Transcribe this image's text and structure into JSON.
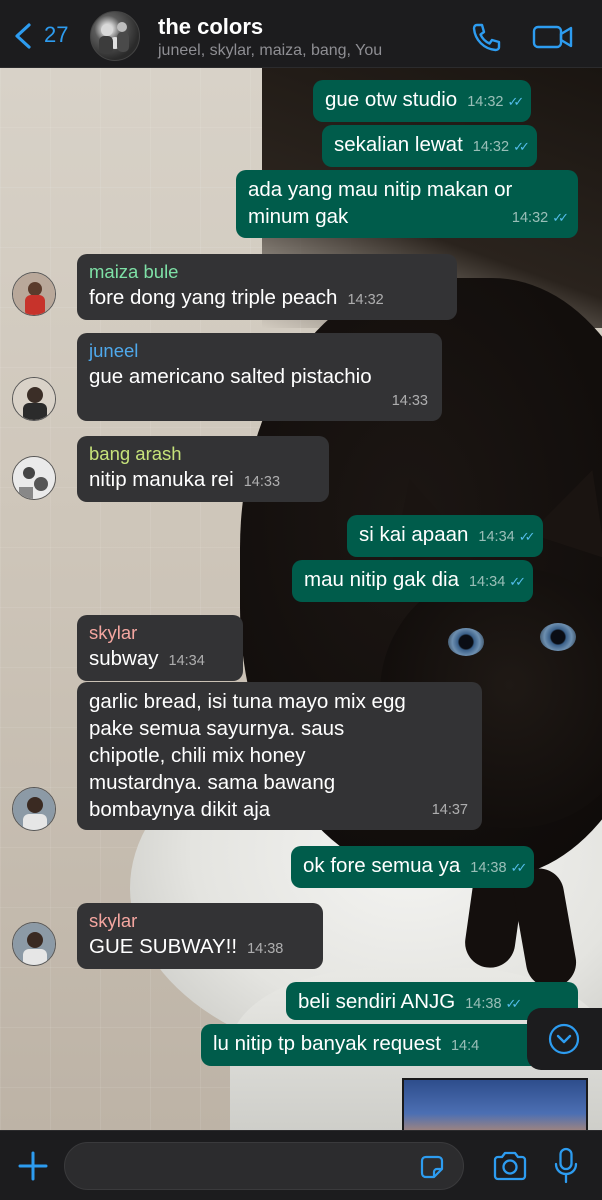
{
  "header": {
    "back_count": "27",
    "title": "the colors",
    "subtitle": "juneel, skylar, maiza, bang, You"
  },
  "messages": [
    {
      "dir": "out",
      "text": "gue otw studio",
      "time": "14:32",
      "ticks": "✓✓"
    },
    {
      "dir": "out",
      "text": "sekalian lewat",
      "time": "14:32",
      "ticks": "✓✓"
    },
    {
      "dir": "out",
      "text_lines": [
        "ada yang mau nitip makan or",
        "minum gak"
      ],
      "time": "14:32",
      "ticks": "✓✓"
    },
    {
      "dir": "in",
      "sender": "maiza bule",
      "sender_color": "#7ee0a6",
      "text": "fore dong yang triple peach",
      "time": "14:32"
    },
    {
      "dir": "in",
      "sender": "juneel",
      "sender_color": "#4fa9ec",
      "text": "gue americano salted pistachio",
      "time": "14:33"
    },
    {
      "dir": "in",
      "sender": "bang arash",
      "sender_color": "#c6e27a",
      "text": "nitip manuka rei",
      "time": "14:33"
    },
    {
      "dir": "out",
      "text": "si kai apaan",
      "time": "14:34",
      "ticks": "✓✓"
    },
    {
      "dir": "out",
      "text": "mau nitip gak dia",
      "time": "14:34",
      "ticks": "✓✓"
    },
    {
      "dir": "in",
      "sender": "skylar",
      "sender_color": "#f4a6a0",
      "text": "subway",
      "time": "14:34"
    },
    {
      "dir": "in",
      "text_lines": [
        "garlic bread, isi tuna mayo mix egg",
        "pake semua sayurnya. saus",
        "chipotle, chili mix honey",
        "mustardnya. sama bawang",
        "bombaynya dikit aja"
      ],
      "time": "14:37"
    },
    {
      "dir": "out",
      "text": "ok fore semua ya",
      "time": "14:38",
      "ticks": "✓✓"
    },
    {
      "dir": "in",
      "sender": "skylar",
      "sender_color": "#f4a6a0",
      "text": "GUE SUBWAY!!",
      "time": "14:38"
    },
    {
      "dir": "out",
      "text": "beli sendiri ANJG",
      "time": "14:38",
      "ticks": "✓✓"
    },
    {
      "dir": "out",
      "text": "lu nitip tp banyak request",
      "time": "14:4"
    }
  ],
  "colors": {
    "outgoing_bubble": "#005c4b",
    "incoming_bubble": "#333335",
    "accent": "#2d9cf0",
    "read_ticks": "#53bdeb"
  },
  "input": {
    "placeholder": "",
    "value": ""
  }
}
